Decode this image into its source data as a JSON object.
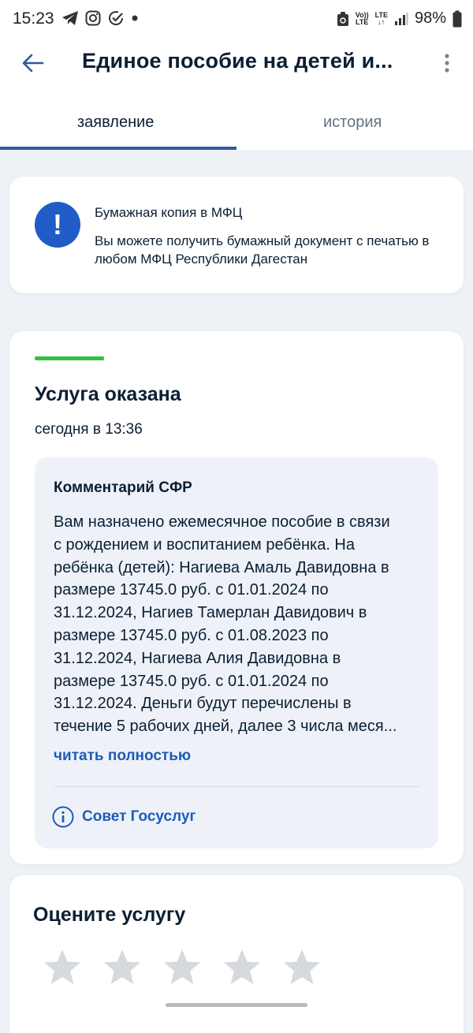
{
  "status_bar": {
    "time": "15:23",
    "volte_top": "Vo))",
    "volte_bottom": "LTE",
    "lte_label": "LTE",
    "battery": "98%"
  },
  "header": {
    "title": "Единое пособие на детей и..."
  },
  "tabs": [
    {
      "label": "заявление",
      "active": true
    },
    {
      "label": "история",
      "active": false
    }
  ],
  "notice": {
    "title": "Бумажная копия в МФЦ",
    "text": "Вы можете получить бумажный документ с печатью в любом МФЦ Республики Дагестан"
  },
  "status": {
    "title": "Услуга оказана",
    "time": "сегодня в 13:36"
  },
  "comment": {
    "title": "Комментарий СФР",
    "lines": [
      "Вам назначено ежемесячное пособие в связи",
      "с рождением и воспитанием ребёнка. На",
      "ребёнка (детей): Нагиева Амаль Давидовна в",
      "размере 13745.0 руб. с 01.01.2024 по",
      "31.12.2024, Нагиев Тамерлан Давидович в",
      "размере 13745.0 руб. с 01.08.2023 по",
      "31.12.2024, Нагиева Алия Давидовна в",
      "размере 13745.0 руб. с 01.01.2024 по",
      "31.12.2024. Деньги будут перечислены в",
      "течение 5 рабочих дней, далее 3 числа меся..."
    ],
    "read_more": "читать полностью",
    "advice": "Совет Госуслуг"
  },
  "rating": {
    "title": "Оцените услугу",
    "stars_total": 5,
    "stars_selected": 0
  },
  "colors": {
    "accent_blue": "#1e5bb8",
    "success_green": "#34c040",
    "star_gray": "#d6d9de"
  }
}
